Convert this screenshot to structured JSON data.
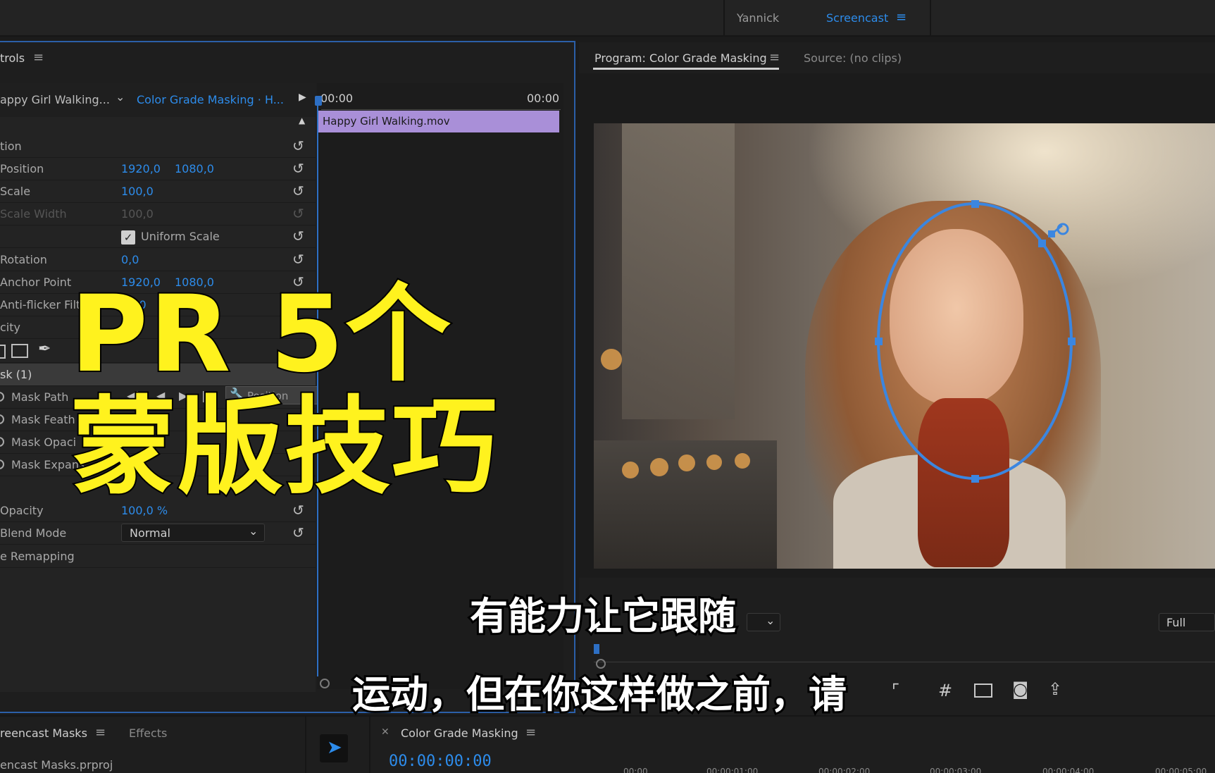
{
  "workspace_bar": {
    "tabs": [
      {
        "label": "Yannick",
        "active": false
      },
      {
        "label": "Screencast",
        "active": true
      }
    ]
  },
  "effect_controls": {
    "panel_title": "trols",
    "clip_source": "appy Girl Walking...",
    "sequence": "Color Grade Masking · H...",
    "timecode_start": "00:00",
    "timecode_end": "00:00",
    "clip_name": "Happy Girl Walking.mov",
    "rows": [
      {
        "label": "tion"
      },
      {
        "label": "Position",
        "v1": "1920,0",
        "v2": "1080,0"
      },
      {
        "label": "Scale",
        "v1": "100,0"
      },
      {
        "label": "Scale Width",
        "v1": "100,0",
        "disabled": true
      },
      {
        "label": "Uniform Scale",
        "checked": true
      },
      {
        "label": "Rotation",
        "v1": "0,0"
      },
      {
        "label": "Anchor Point",
        "v1": "1920,0",
        "v2": "1080,0"
      },
      {
        "label": "Anti-flicker Filt",
        "v1": "0,00"
      },
      {
        "label": "city"
      },
      {
        "label": "sk (1)"
      },
      {
        "label": "Mask Path"
      },
      {
        "label": "Mask Feath"
      },
      {
        "label": "Mask Opaci"
      },
      {
        "label": "Mask Expans"
      },
      {
        "label": "Opacity",
        "v1": "100,0 %"
      },
      {
        "label": "Blend Mode",
        "select": "Normal"
      },
      {
        "label": "e Remapping"
      }
    ],
    "tooltip": "Position"
  },
  "program_monitor": {
    "title": "Program: Color Grade Masking",
    "source_tab": "Source: (no clips)",
    "resolution": "Full"
  },
  "bottom_panels": {
    "project_tab": "reencast Masks",
    "effects_tab": "Effects",
    "project_file": "encast Masks.prproj",
    "sequence_tab": "Color Grade Masking",
    "timecode": "00:00:00:00",
    "ruler": [
      "00:00",
      "00:00:01:00",
      "00:00:02:00",
      "00:00:03:00",
      "00:00:04:00",
      "00:00:05:00"
    ]
  },
  "overlay": {
    "title_line1": "PR 5个",
    "title_line2": "蒙版技巧",
    "subtitle_line1": "有能力让它跟随",
    "subtitle_line2": "运动，但在你这样做之前，请"
  },
  "colors": {
    "accent": "#2d8ceb",
    "clip": "#a98fd8",
    "title_yellow": "#fff21e",
    "mask": "#3b86e0"
  }
}
